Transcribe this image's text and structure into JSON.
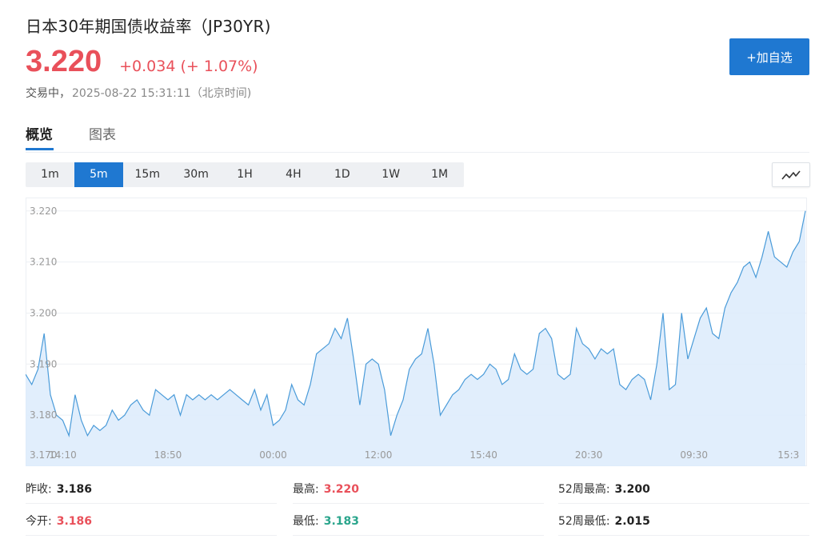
{
  "header": {
    "title": "日本30年期国债收益率（JP30YR)",
    "price": "3.220",
    "change": "+0.034 (+ 1.07%)",
    "status": "交易中，",
    "timestamp": "2025-08-22 15:31:11（北京时间)",
    "follow_label": "+加自选"
  },
  "tabs": [
    {
      "label": "概览",
      "active": true
    },
    {
      "label": "图表",
      "active": false
    }
  ],
  "intervals": [
    {
      "label": "1m",
      "active": false
    },
    {
      "label": "5m",
      "active": true
    },
    {
      "label": "15m",
      "active": false
    },
    {
      "label": "30m",
      "active": false
    },
    {
      "label": "1H",
      "active": false
    },
    {
      "label": "4H",
      "active": false
    },
    {
      "label": "1D",
      "active": false
    },
    {
      "label": "1W",
      "active": false
    },
    {
      "label": "1M",
      "active": false
    }
  ],
  "chart_type_icon": "line-chart-icon",
  "colors": {
    "accent": "#1f78d1",
    "up": "#e9505a",
    "down": "#2aa58c",
    "line": "#4a9bd9",
    "fill": "#dcebfb"
  },
  "chart_data": {
    "type": "area",
    "ylim": [
      3.17,
      3.222
    ],
    "y_ticks": [
      "3.220",
      "3.210",
      "3.200",
      "3.190",
      "3.180",
      "3.170"
    ],
    "y_tick_values": [
      3.22,
      3.21,
      3.2,
      3.19,
      3.18,
      3.17
    ],
    "x_ticks": [
      "14:10",
      "18:50",
      "00:00",
      "12:00",
      "15:40",
      "20:30",
      "09:30",
      "15:3"
    ],
    "x_tick_index": [
      6,
      23,
      40,
      57,
      74,
      91,
      108,
      125
    ],
    "grid": true,
    "values": [
      3.188,
      3.186,
      3.189,
      3.196,
      3.184,
      3.18,
      3.179,
      3.176,
      3.184,
      3.179,
      3.176,
      3.178,
      3.177,
      3.178,
      3.181,
      3.179,
      3.18,
      3.182,
      3.183,
      3.181,
      3.18,
      3.185,
      3.184,
      3.183,
      3.184,
      3.18,
      3.184,
      3.183,
      3.184,
      3.183,
      3.184,
      3.183,
      3.184,
      3.185,
      3.184,
      3.183,
      3.182,
      3.185,
      3.181,
      3.184,
      3.178,
      3.179,
      3.181,
      3.186,
      3.183,
      3.182,
      3.186,
      3.192,
      3.193,
      3.194,
      3.197,
      3.195,
      3.199,
      3.191,
      3.182,
      3.19,
      3.191,
      3.19,
      3.185,
      3.176,
      3.18,
      3.183,
      3.189,
      3.191,
      3.192,
      3.197,
      3.19,
      3.18,
      3.182,
      3.184,
      3.185,
      3.187,
      3.188,
      3.187,
      3.188,
      3.19,
      3.189,
      3.186,
      3.187,
      3.192,
      3.189,
      3.188,
      3.189,
      3.196,
      3.197,
      3.195,
      3.188,
      3.187,
      3.188,
      3.197,
      3.194,
      3.193,
      3.191,
      3.193,
      3.192,
      3.193,
      3.186,
      3.185,
      3.187,
      3.188,
      3.187,
      3.183,
      3.19,
      3.2,
      3.185,
      3.186,
      3.2,
      3.191,
      3.195,
      3.199,
      3.201,
      3.196,
      3.195,
      3.201,
      3.204,
      3.206,
      3.209,
      3.21,
      3.207,
      3.211,
      3.216,
      3.211,
      3.21,
      3.209,
      3.212,
      3.214,
      3.22
    ]
  },
  "stats": [
    {
      "label": "昨收:",
      "value": "3.186",
      "tone": "dark"
    },
    {
      "label": "最高:",
      "value": "3.220",
      "tone": "red"
    },
    {
      "label": "52周最高:",
      "value": "3.200",
      "tone": "dark"
    },
    {
      "label": "今开:",
      "value": "3.186",
      "tone": "red"
    },
    {
      "label": "最低:",
      "value": "3.183",
      "tone": "green"
    },
    {
      "label": "52周最低:",
      "value": "2.015",
      "tone": "dark"
    }
  ]
}
